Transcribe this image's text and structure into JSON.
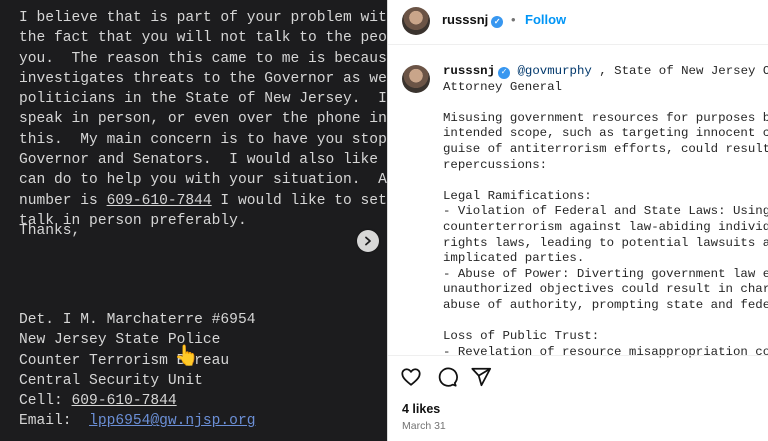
{
  "photo": {
    "body_lines": [
      "I believe that is part of your problem with your complaint,",
      "the fact that you will not talk to the people trying to help",
      "you.  The reason this came to me is because my unit",
      "investigates threats to the Governor as well as",
      "politicians in the State of New Jersey.  I would like to",
      "speak in person, or even over the phone in regards to",
      "this.  My main concern is to have you stop cc'ing the",
      "Governor and Senators.  I would also like to see what I",
      "can do to help you with your situation.  Again, my"
    ],
    "number_prefix": "number is ",
    "phone": "609-610-7844",
    "number_suffix": " I would like to set up a time to",
    "last_line": "talk in person preferably.",
    "thanks": "Thanks,",
    "sig_name": "Det. I M. Marchaterre #6954",
    "sig_org": "New Jersey State Police",
    "sig_bureau": "Counter Terrorism Bureau",
    "sig_unit": "Central Security Unit",
    "cell_label": "Cell: ",
    "cell": "609-610-7844",
    "email_label": "Email:  ",
    "email": "lpp6954@gw.njsp.org",
    "hand_emoji": "👆",
    "next_icon": "chevron-right"
  },
  "post": {
    "username": "russsnj",
    "verified_mark": "✓",
    "separator": "•",
    "follow_label": "Follow",
    "caption": {
      "mention": "@govmurphy",
      "line1_rest": " , State of New Jersey Office of the",
      "line2": "Attorney General",
      "lines": [
        "",
        "Misusing government resources for purposes beyond their",
        "intended scope, such as targeting innocent citizens under the",
        "guise of antiterrorism efforts, could result in severe",
        "repercussions:",
        "",
        "Legal Ramifications:",
        "- Violation of Federal and State Laws: Using resources meant",
        "counterterrorism against law-abiding individuals may breach",
        "rights laws, leading to potential lawsuits against the state or",
        "implicated parties.",
        "- Abuse of Power: Diverting government law enforcement fo",
        "unauthorized objectives could result in charges of misconduc",
        "abuse of authority, prompting state and federal inquiries.",
        "",
        "Loss of Public Trust:",
        "- Revelation of resource misappropriation could undermine"
      ]
    },
    "likes": "4 likes",
    "date": "March 31",
    "icons": [
      "heart-icon",
      "comment-icon",
      "share-icon"
    ],
    "colors": {
      "link": "#0095f6",
      "verified": "#3897f0",
      "photo_bg": "#1c1c1e"
    }
  }
}
